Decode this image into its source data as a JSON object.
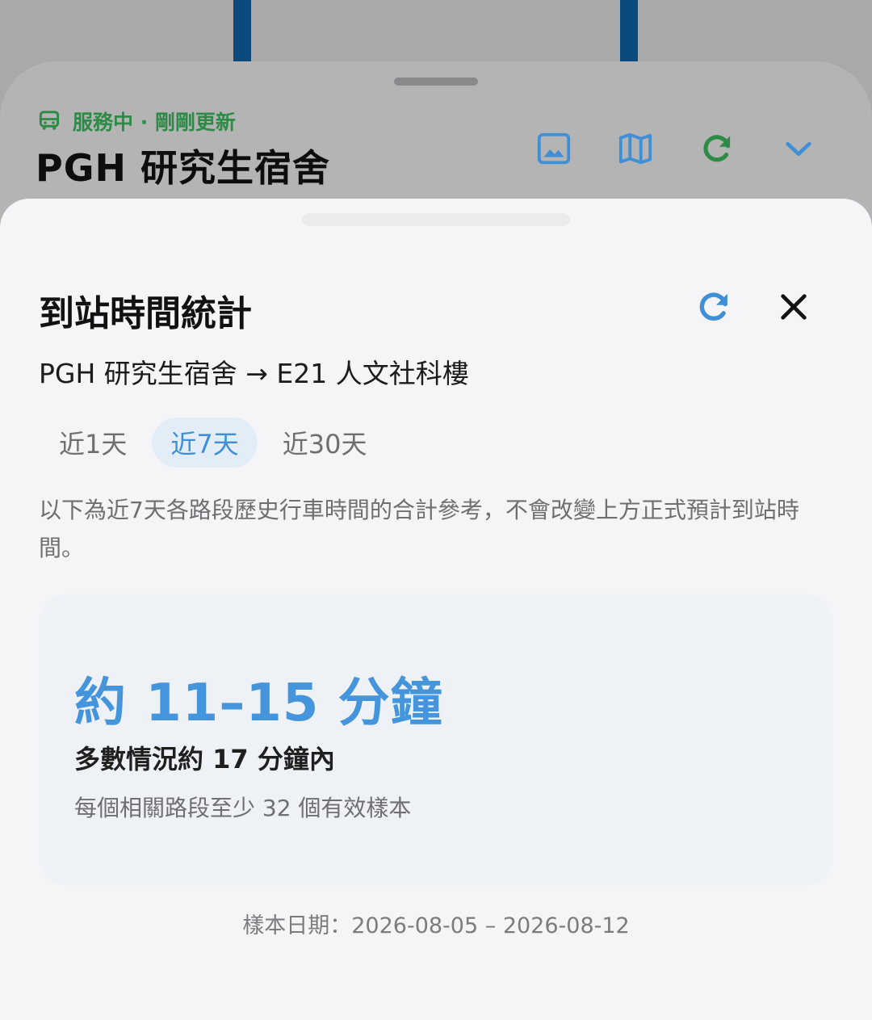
{
  "station": {
    "status": "服務中 · 剛剛更新",
    "title": "PGH 研究生宿舍",
    "status_color": "#2e8b47",
    "status_icon": "bus-icon",
    "actions": [
      {
        "icon": "image-icon",
        "color": "#3e8fd6"
      },
      {
        "icon": "map-icon",
        "color": "#3e8fd6"
      },
      {
        "icon": "refresh-icon",
        "color": "#2e8b47"
      },
      {
        "icon": "chevron-down-icon",
        "color": "#3e8fd6"
      }
    ]
  },
  "stats": {
    "title": "到站時間統計",
    "route": "PGH 研究生宿舍 → E21 人文社科樓",
    "refresh_icon": "refresh-icon",
    "close_icon": "close-icon",
    "tabs": [
      {
        "label": "近1天",
        "active": false
      },
      {
        "label": "近7天",
        "active": true
      },
      {
        "label": "近30天",
        "active": false
      }
    ],
    "note": "以下為近7天各路段歷史行車時間的合計參考，不會改變上方正式預計到站時間。",
    "result": {
      "range": "約 11–15 分鐘",
      "typical": "多數情況約 17 分鐘內",
      "samples": "每個相關路段至少 32 個有效樣本"
    },
    "date_range": "樣本日期：2026-08-05 – 2026-08-12"
  },
  "colors": {
    "accent": "#3e8fd6",
    "status_green": "#2e8b47",
    "route_line": "#0a4a7d"
  }
}
